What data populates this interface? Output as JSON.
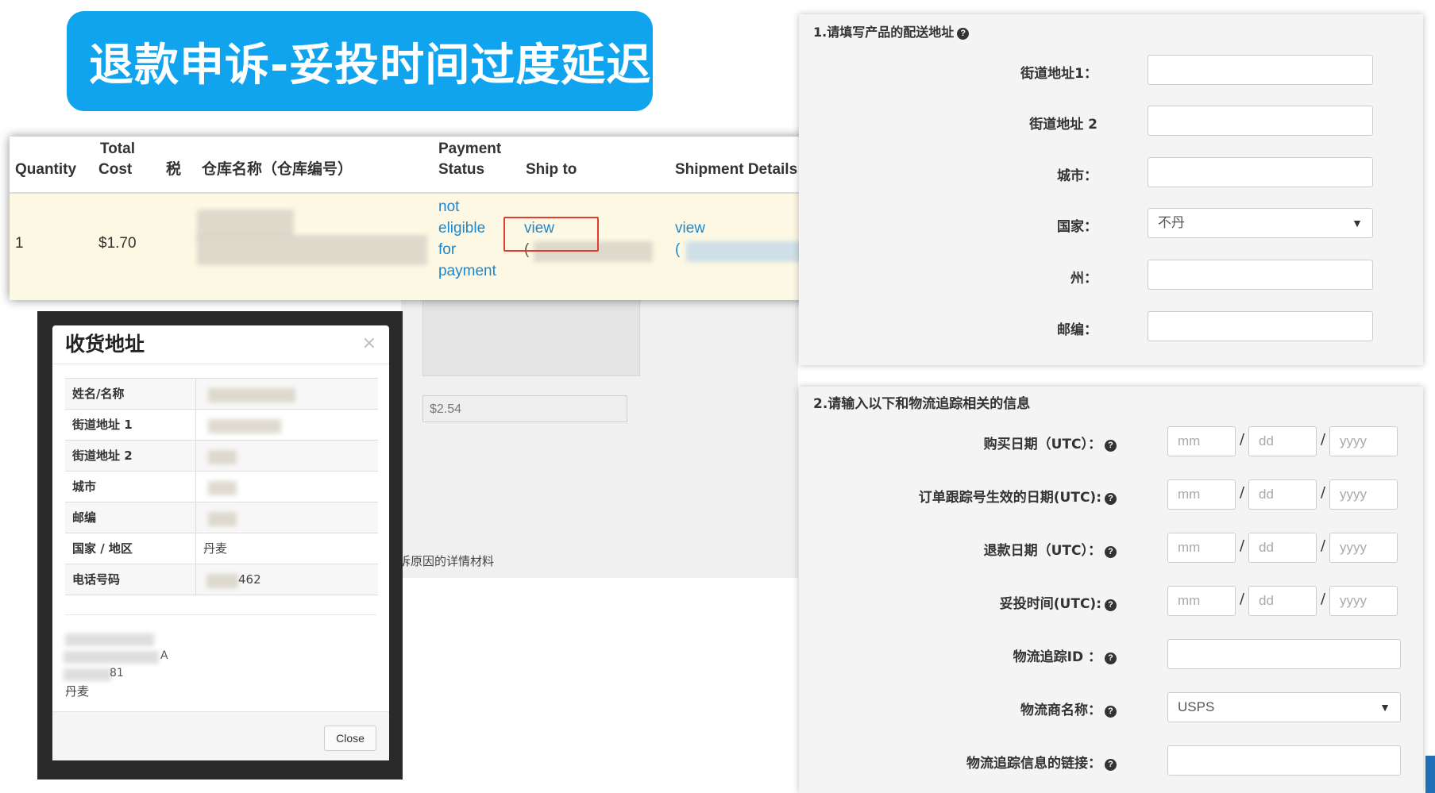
{
  "banner": {
    "title": "退款申诉-妥投时间过度延迟"
  },
  "background": {
    "price": "$2.54",
    "note": "诉原因的详情材料",
    "frag_not": "not"
  },
  "order_table": {
    "headers": {
      "quantity": "Quantity",
      "total_cost_1": "Total",
      "total_cost_2": "Cost",
      "tax": "税",
      "warehouse": "仓库名称（仓库编号）",
      "payment_1": "Payment",
      "payment_2": "Status",
      "ship_to": "Ship to",
      "shipment_details": "Shipment Details"
    },
    "row": {
      "quantity": "1",
      "total_cost": "$1.70",
      "payment_status": [
        "not",
        "eligible",
        "for",
        "payment"
      ],
      "ship_to_link": "view",
      "shipment_link": "view",
      "shipment_paren": "(",
      "ship_paren": "("
    }
  },
  "modal": {
    "title": "收货地址",
    "close_x": "×",
    "rows": [
      {
        "key": "姓名/名称",
        "value": ""
      },
      {
        "key": "街道地址 1",
        "value": ""
      },
      {
        "key": "街道地址 2",
        "value": ""
      },
      {
        "key": "城市",
        "value": ""
      },
      {
        "key": "邮编",
        "value": ""
      },
      {
        "key": "国家 / 地区",
        "value": "丹麦"
      },
      {
        "key": "电话号码",
        "value": "462"
      }
    ],
    "addr_lines": [
      "A",
      "81",
      "丹麦"
    ],
    "close_button": "Close"
  },
  "form1": {
    "heading": "1.请填写产品的配送地址",
    "fields": {
      "street1": "街道地址1：",
      "street2": "街道地址 2",
      "city": "城市：",
      "country": "国家：",
      "state": "州：",
      "zip": "邮编："
    },
    "country_value": "不丹"
  },
  "form2": {
    "heading": "2.请输入以下和物流追踪相关的信息",
    "fields": {
      "purchase_date": "购买日期（UTC）：",
      "tracking_date": "订单跟踪号生效的日期(UTC):",
      "refund_date": "退款日期（UTC）：",
      "delivery_time": "妥投时间(UTC):",
      "tracking_id": "物流追踪ID ：",
      "carrier": "物流商名称：",
      "tracking_link": "物流追踪信息的链接："
    },
    "placeholders": {
      "mm": "mm",
      "dd": "dd",
      "yyyy": "yyyy"
    },
    "carrier_value": "USPS",
    "slash": "/"
  },
  "icons": {
    "help": "question-circle-icon",
    "caret": "caret-down-icon"
  },
  "colors": {
    "banner": "#10a4ee",
    "link": "#1f86c9",
    "highlight_row": "#fcf8e3",
    "red_box": "#e53b2c"
  }
}
